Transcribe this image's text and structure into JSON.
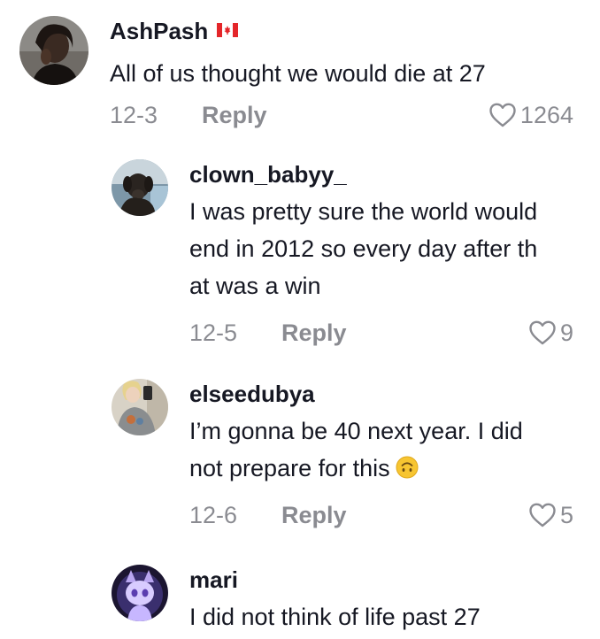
{
  "comments": [
    {
      "username": "AshPash",
      "flag": "canada-flag-icon",
      "text": "All of us thought we would die at 27",
      "date": "12-3",
      "reply_label": "Reply",
      "likes": "1264",
      "avatar": "user-avatar-photo"
    }
  ],
  "replies": [
    {
      "username": "clown_babyy_",
      "text_lines": [
        "I was pretty sure the world would",
        "end in 2012 so every day after th",
        "at was a win"
      ],
      "date": "12-5",
      "reply_label": "Reply",
      "likes": "9",
      "avatar": "dog-avatar-photo"
    },
    {
      "username": "elseedubya",
      "text_lines": [
        "I’m gonna be 40 next year. I did",
        "not prepare for this"
      ],
      "emoji": "upside-down-face-emoji-icon",
      "date": "12-6",
      "reply_label": "Reply",
      "likes": "5",
      "avatar": "mirror-selfie-avatar-photo"
    },
    {
      "username": "mari",
      "text": "I did not think of life past 27",
      "avatar": "anime-cat-avatar"
    }
  ],
  "colors": {
    "text": "#161823",
    "muted": "rgba(22,24,35,0.5)",
    "flag_red": "#e4262a"
  }
}
